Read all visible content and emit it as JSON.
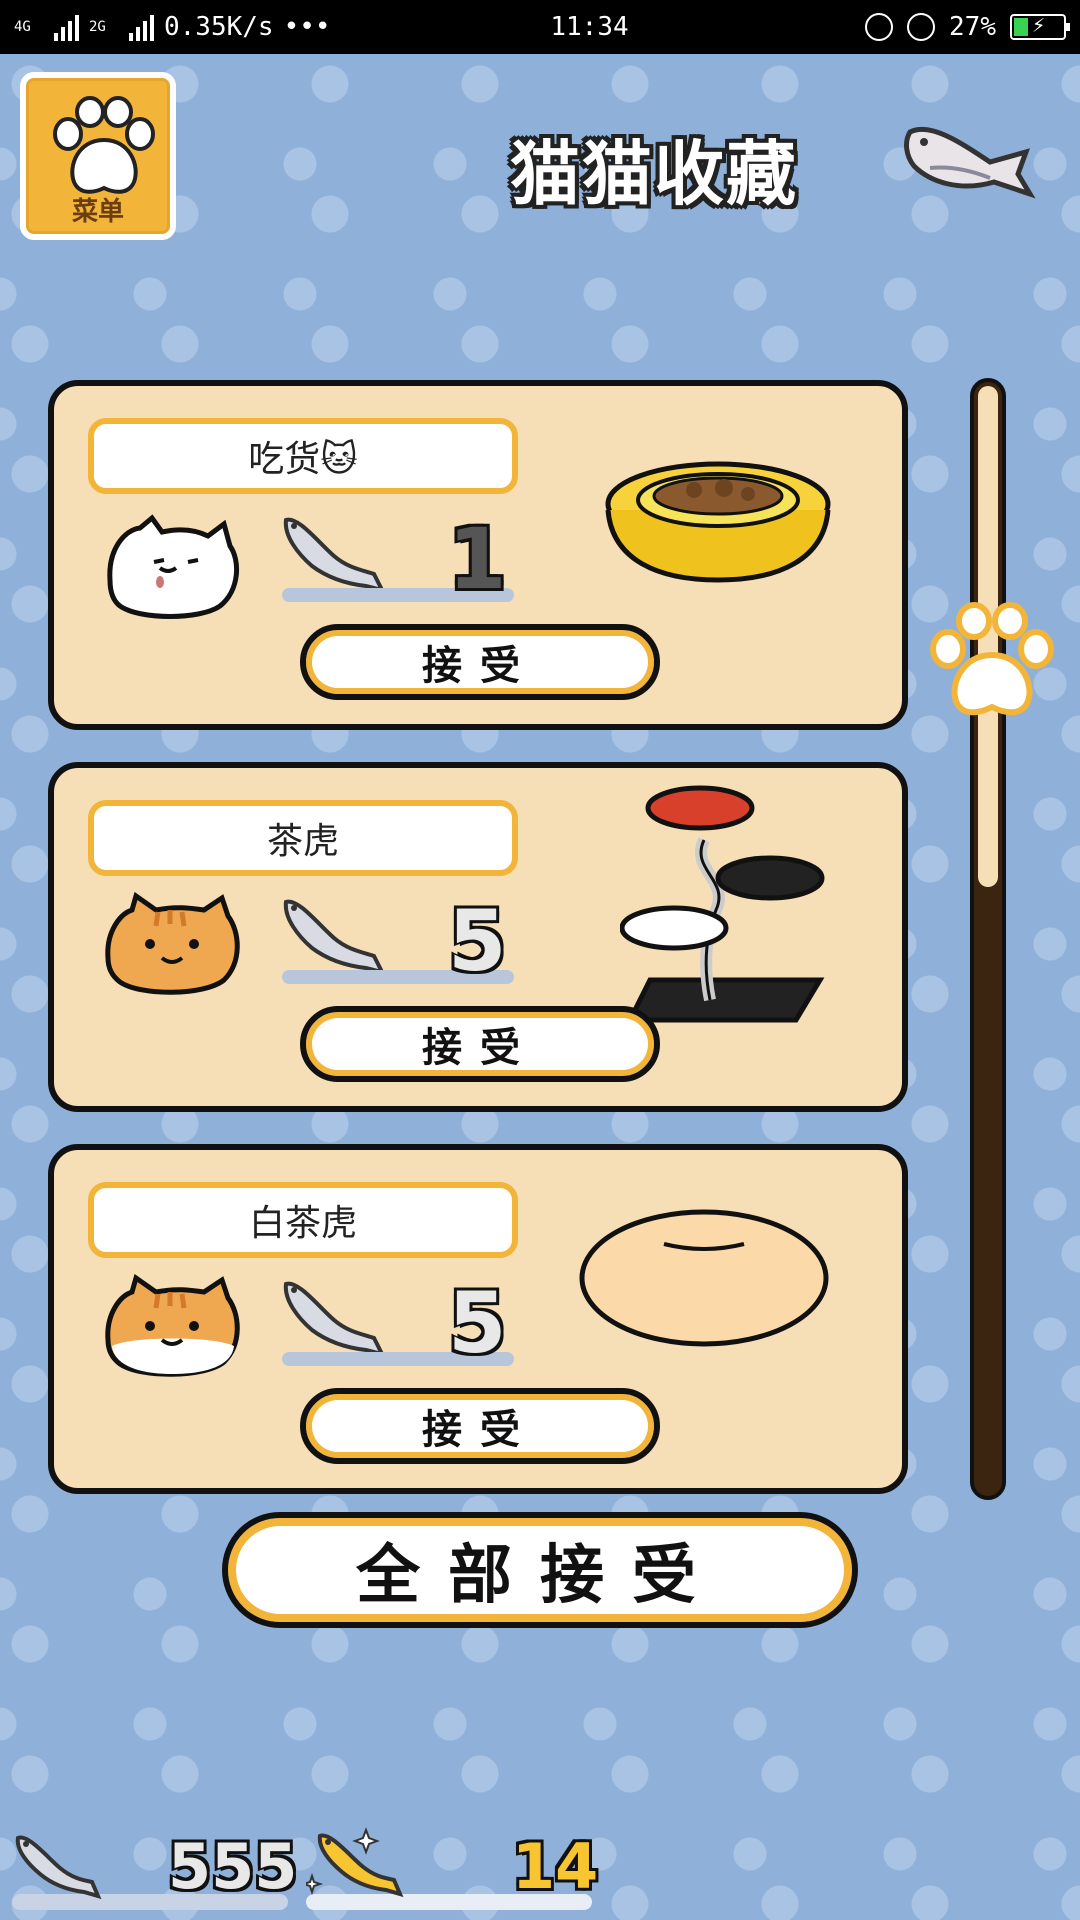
{
  "status_bar": {
    "network_1": "4G",
    "network_2": "4G",
    "network_3": "2G",
    "speed": "0.35K/s",
    "more": "•••",
    "time": "11:34",
    "battery_percent": "27%"
  },
  "header": {
    "menu_label": "菜单",
    "title": "猫猫收藏"
  },
  "gifts": [
    {
      "cat_name": "吃货🐱",
      "reward": "1",
      "accept_label": "接受",
      "goods": "food-bowl"
    },
    {
      "cat_name": "茶虎",
      "reward": "5",
      "accept_label": "接受",
      "goods": "cat-tower"
    },
    {
      "cat_name": "白茶虎",
      "reward": "5",
      "accept_label": "接受",
      "goods": "cushion"
    }
  ],
  "accept_all_label": "全部接受",
  "currency": {
    "silver_fish": "555",
    "gold_fish": "14"
  },
  "colors": {
    "accent": "#f2b53a",
    "card": "#f6deb6",
    "background": "#8fb0d8",
    "scroll_track": "#3b2410"
  },
  "scroll_position": 0.45
}
